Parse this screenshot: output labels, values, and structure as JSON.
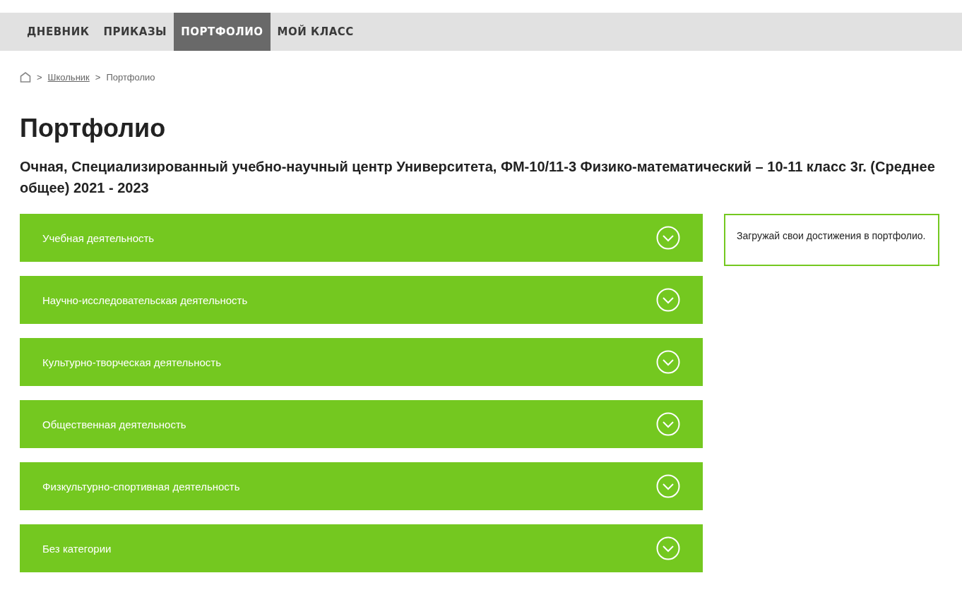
{
  "nav": {
    "tabs": [
      {
        "label": "ДНЕВНИК",
        "selected": false
      },
      {
        "label": "ПРИКАЗЫ",
        "selected": false
      },
      {
        "label": "ПОРТФОЛИО",
        "selected": true
      },
      {
        "label": "МОЙ КЛАСС",
        "selected": false
      }
    ]
  },
  "breadcrumb": {
    "items": [
      {
        "label": "Школьник",
        "kind": "link"
      },
      {
        "label": "Портфолио",
        "kind": "current"
      }
    ],
    "separator": ">"
  },
  "title": "Портфолио",
  "subtitle": "Очная, Специализированный учебно-научный центр Университета, ФМ-10/11-3 Физико-математический – 10-11 класс 3г. (Среднее общее) 2021 - 2023",
  "sections": [
    {
      "label": "Учебная деятельность",
      "expanded": false
    },
    {
      "label": "Научно-исследовательская деятельность",
      "expanded": false
    },
    {
      "label": "Культурно-творческая деятельность",
      "expanded": false
    },
    {
      "label": "Общественная деятельность",
      "expanded": false
    },
    {
      "label": "Физкультурно-спортивная деятельность",
      "expanded": false
    },
    {
      "label": "Без категории",
      "expanded": false
    }
  ],
  "info_box": {
    "text": "Загружай свои достижения в портфолио."
  }
}
